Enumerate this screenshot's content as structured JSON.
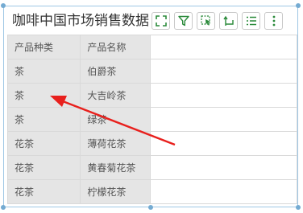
{
  "widget": {
    "title": "咖啡中国市场销售数据",
    "toolbar": [
      {
        "icon": "fullscreen-icon"
      },
      {
        "icon": "filter-icon"
      },
      {
        "icon": "select-icon"
      },
      {
        "icon": "drill-icon"
      },
      {
        "icon": "list-icon"
      },
      {
        "icon": "more-icon"
      }
    ]
  },
  "table": {
    "headers": [
      "产品种类",
      "产品名称"
    ],
    "rows": [
      [
        "茶",
        "伯爵茶"
      ],
      [
        "茶",
        "大吉岭茶"
      ],
      [
        "茶",
        "绿茶"
      ],
      [
        "花茶",
        "薄荷花茶"
      ],
      [
        "花茶",
        "黄春菊花茶"
      ],
      [
        "花茶",
        "柠檬花茶"
      ]
    ]
  },
  "colors": {
    "accent": "#74abd2",
    "arrow": "#e8201d"
  }
}
